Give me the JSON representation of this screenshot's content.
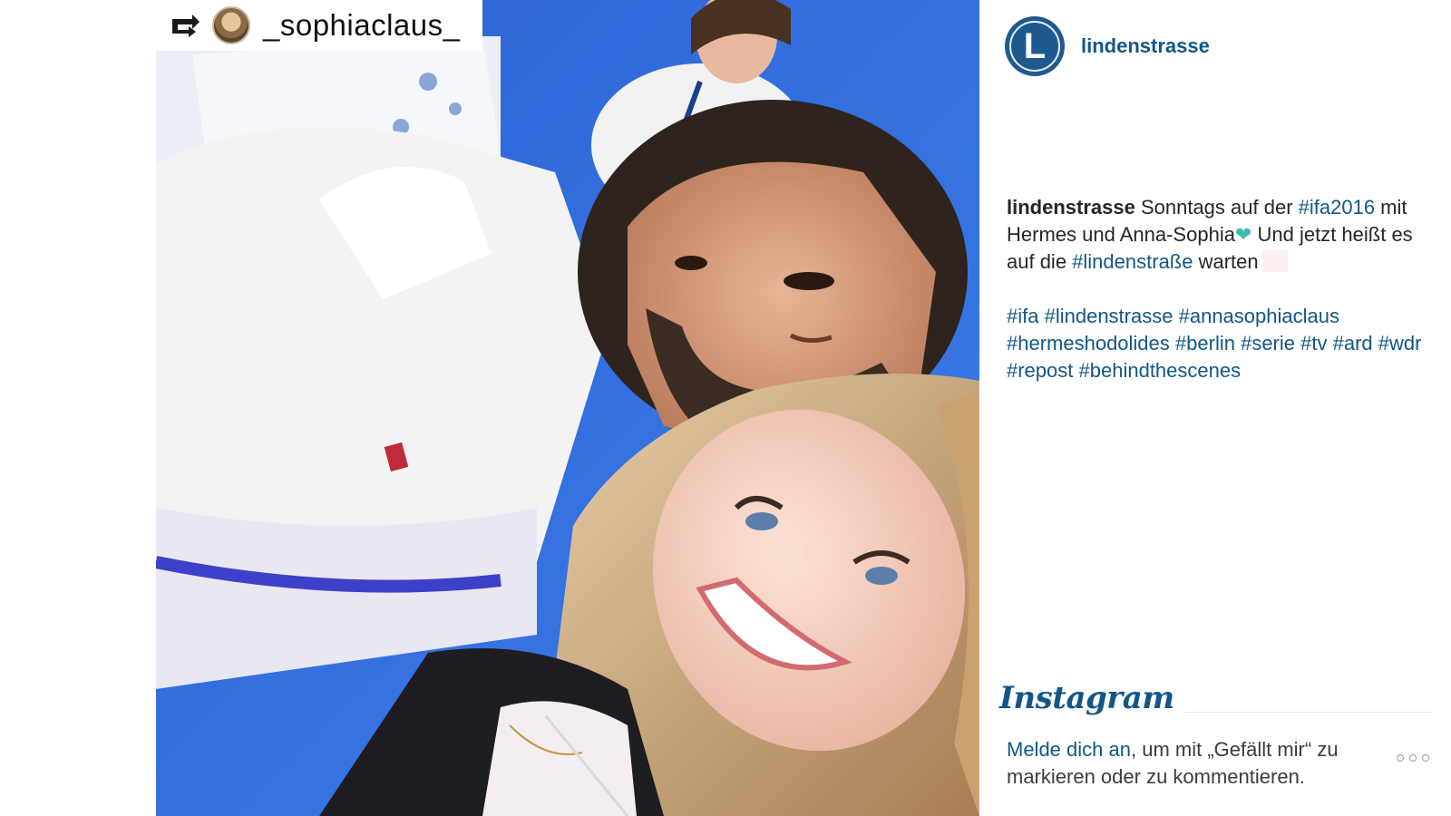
{
  "post": {
    "repost_username": "_sophiaclaus_",
    "account_letter": "L",
    "account_name": "lindenstrasse",
    "caption": {
      "author": "lindenstrasse",
      "text_1": " Sonntags auf der ",
      "tag_ifa2016": "#ifa2016",
      "text_2": " mit Hermes und Anna-Sophia",
      "heart": "❤",
      "text_3": " Und jetzt heißt es auf die ",
      "tag_lindenstrasse_sz": "#lindenstraße",
      "text_4": " warten"
    },
    "hashtags": [
      "#ifa",
      "#lindenstrasse",
      "#annasophiaclaus",
      "#hermeshodolides",
      "#berlin",
      "#serie",
      "#tv",
      "#ard",
      "#wdr",
      "#repost",
      "#behindthescenes"
    ]
  },
  "footer": {
    "brand": "Instagram",
    "login_link": "Melde dich an",
    "login_rest": ", um mit „Gefällt mir“ zu markieren oder zu kommentieren."
  },
  "icons": {
    "repost": "repost-icon",
    "more": "more-options-icon",
    "heart": "heart-emoji-icon"
  },
  "colors": {
    "link": "#125688",
    "heart": "#3dbab5",
    "avatar_bg": "#1f5a8f"
  }
}
